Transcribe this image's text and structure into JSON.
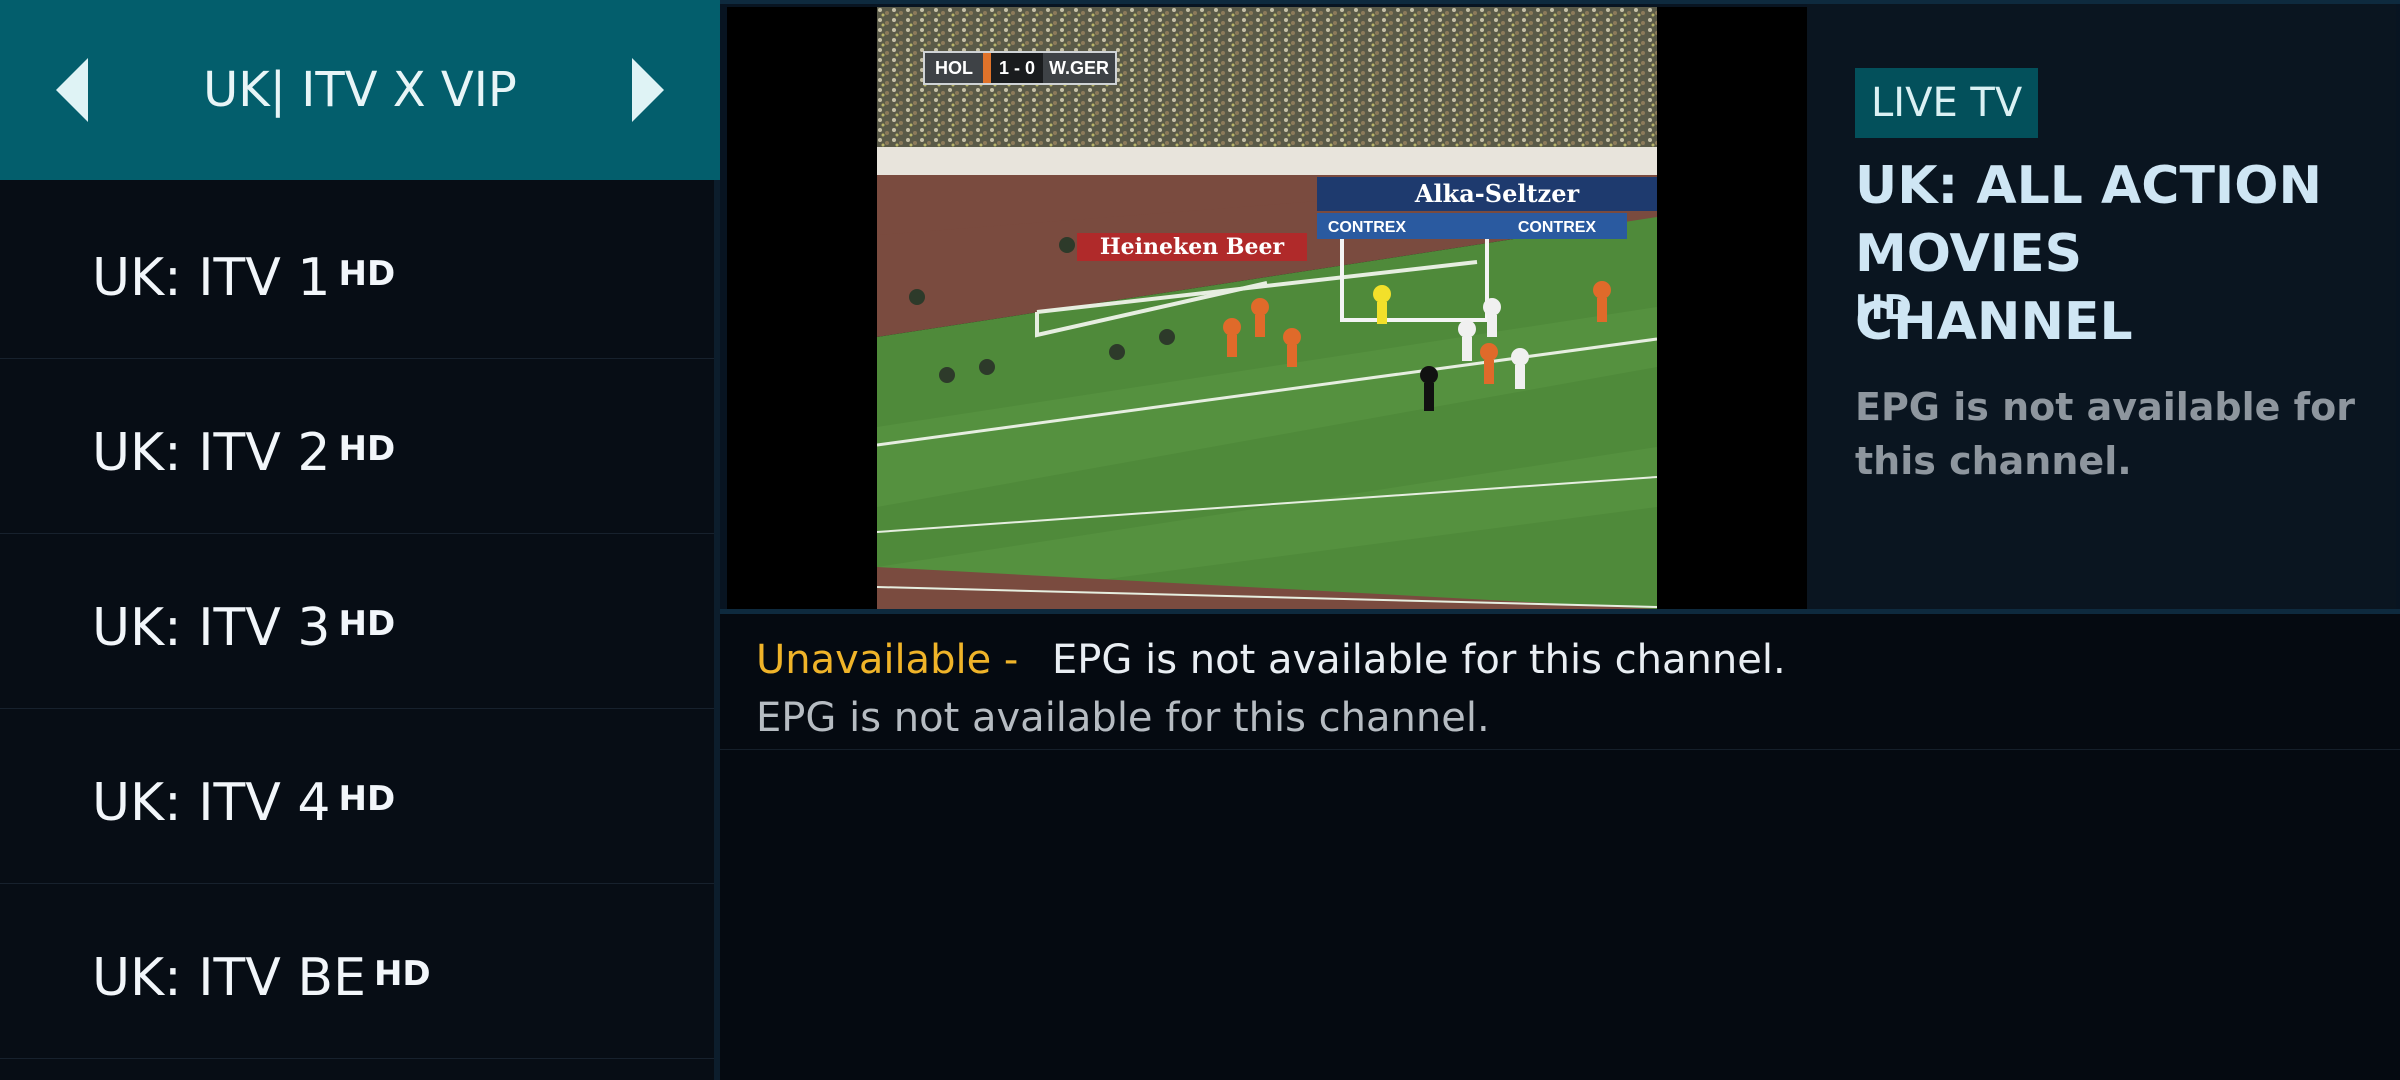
{
  "sidebar": {
    "category_title": "UK| ITV X VIP",
    "channels": [
      {
        "name": "UK: ITV 1",
        "tag": "HD"
      },
      {
        "name": "UK: ITV 2",
        "tag": "HD"
      },
      {
        "name": "UK: ITV 3",
        "tag": "HD"
      },
      {
        "name": "UK: ITV 4",
        "tag": "HD"
      },
      {
        "name": "UK: ITV BE",
        "tag": "HD"
      }
    ]
  },
  "player": {
    "scorebug": {
      "home": "HOL",
      "score": "1 - 0",
      "away": "W.GER"
    }
  },
  "info": {
    "badge": "LIVE TV",
    "channel_title": "UK: ALL ACTION MOVIES CHANNEL",
    "channel_tag": "HD",
    "epg_note": "EPG is not available for this channel."
  },
  "epg": {
    "status": "Unavailable -",
    "now": "EPG is not available for this channel.",
    "next": "EPG is not available for this channel."
  },
  "colors": {
    "header_teal": "#035e6c",
    "badge_teal": "#03505b",
    "status_yellow": "#f0b429",
    "background": "#050a11"
  },
  "icons": {
    "prev": "caret-left-icon",
    "next": "caret-right-icon"
  }
}
